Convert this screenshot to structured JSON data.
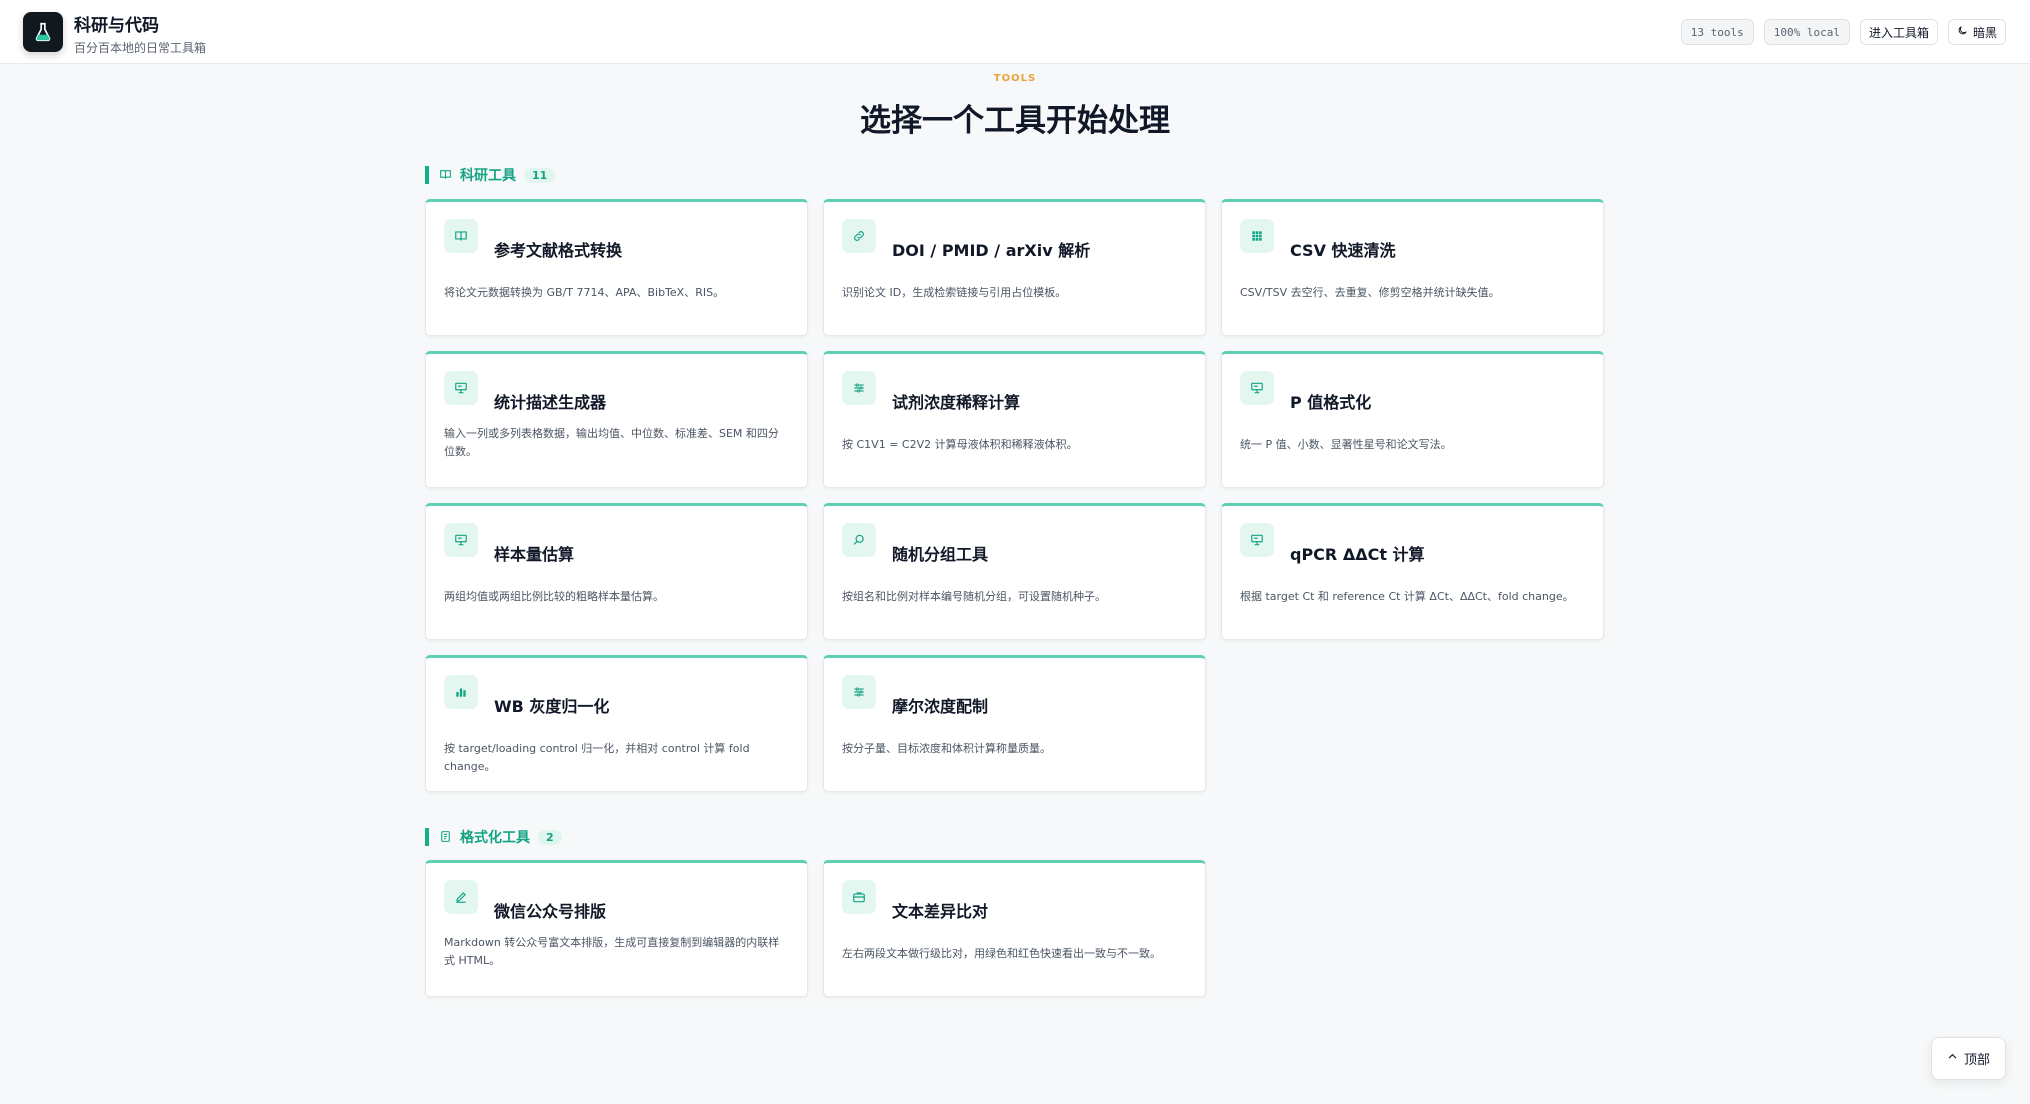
{
  "header": {
    "title": "科研与代码",
    "subtitle": "百分百本地的日常工具箱",
    "tools_chip": "13 tools",
    "local_chip": "100% local",
    "enter_button": "进入工具箱",
    "theme_button": "暗黑"
  },
  "hero": {
    "eyebrow": "TOOLS",
    "title": "选择一个工具开始处理"
  },
  "sections": [
    {
      "title": "科研工具",
      "count": "11",
      "icon": "book-icon",
      "tools": [
        {
          "title": "参考文献格式转换",
          "desc": "将论文元数据转换为 GB/T 7714、APA、BibTeX、RIS。",
          "icon": "book-icon"
        },
        {
          "title": "DOI / PMID / arXiv 解析",
          "desc": "识别论文 ID，生成检索链接与引用占位模板。",
          "icon": "link-icon"
        },
        {
          "title": "CSV 快速清洗",
          "desc": "CSV/TSV 去空行、去重复、修剪空格并统计缺失值。",
          "icon": "grid-icon"
        },
        {
          "title": "统计描述生成器",
          "desc": "输入一列或多列表格数据，输出均值、中位数、标准差、SEM 和四分位数。",
          "icon": "presentation-icon"
        },
        {
          "title": "试剂浓度稀释计算",
          "desc": "按 C1V1 = C2V2 计算母液体积和稀释液体积。",
          "icon": "sliders-icon"
        },
        {
          "title": "P 值格式化",
          "desc": "统一 P 值、小数、显著性星号和论文写法。",
          "icon": "presentation-icon"
        },
        {
          "title": "样本量估算",
          "desc": "两组均值或两组比例比较的粗略样本量估算。",
          "icon": "presentation-icon"
        },
        {
          "title": "随机分组工具",
          "desc": "按组名和比例对样本编号随机分组，可设置随机种子。",
          "icon": "search-icon"
        },
        {
          "title": "qPCR ΔΔCt 计算",
          "desc": "根据 target Ct 和 reference Ct 计算 ΔCt、ΔΔCt、fold change。",
          "icon": "presentation-icon"
        },
        {
          "title": "WB 灰度归一化",
          "desc": "按 target/loading control 归一化，并相对 control 计算 fold change。",
          "icon": "bar-chart-icon"
        },
        {
          "title": "摩尔浓度配制",
          "desc": "按分子量、目标浓度和体积计算称量质量。",
          "icon": "sliders-icon"
        }
      ]
    },
    {
      "title": "格式化工具",
      "count": "2",
      "icon": "document-icon",
      "tools": [
        {
          "title": "微信公众号排版",
          "desc": "Markdown 转公众号富文本排版，生成可直接复制到编辑器的内联样式 HTML。",
          "icon": "pen-icon"
        },
        {
          "title": "文本差异比对",
          "desc": "左右两段文本做行级比对，用绿色和红色快速看出一致与不一致。",
          "icon": "briefcase-icon"
        }
      ]
    }
  ],
  "top_button": "顶部",
  "colors": {
    "accent": "#14b08a",
    "accent_light": "#e4f6f0",
    "eyebrow": "#e8a33b",
    "logo_bg": "#111820"
  }
}
